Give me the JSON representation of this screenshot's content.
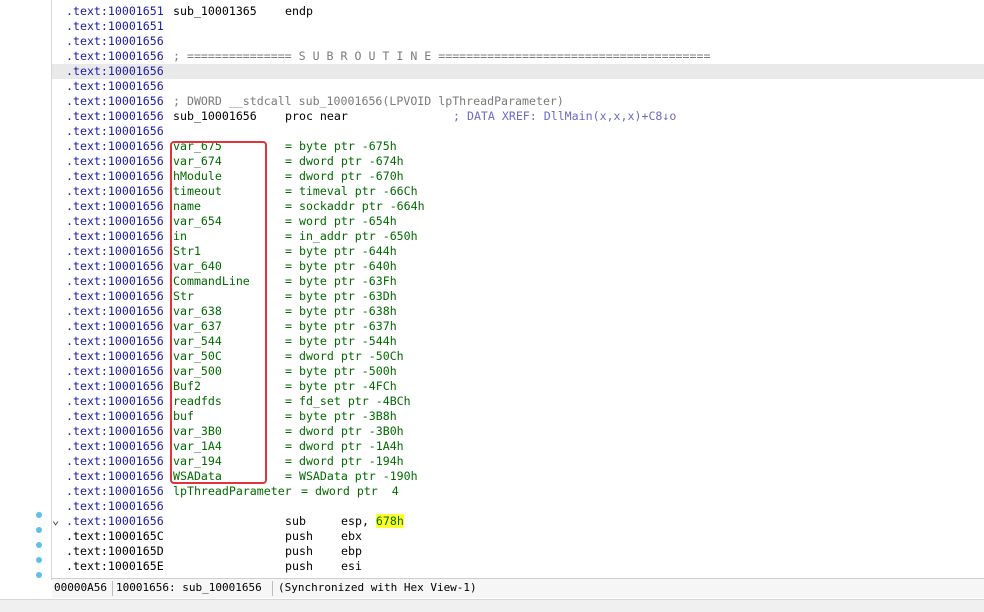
{
  "lines": [
    {
      "addr": ".text:10001651",
      "c2": "sub_10001365",
      "c3": "endp"
    },
    {
      "addr": ".text:10001651"
    },
    {
      "addr": ".text:10001656"
    },
    {
      "addr": ".text:10001656",
      "c2": "; =============== S U B R O U T I N E ======================================="
    },
    {
      "addr": ".text:10001656",
      "sel": true
    },
    {
      "addr": ".text:10001656"
    },
    {
      "addr": ".text:10001656",
      "c2": "; DWORD __stdcall sub_10001656(LPVOID lpThreadParameter)"
    },
    {
      "addr": ".text:10001656",
      "c2": "sub_10001656",
      "c3": "proc near",
      "c5": "; DATA XREF: DllMain(x,x,x)+C8↓o"
    },
    {
      "addr": ".text:10001656"
    },
    {
      "addr": ".text:10001656",
      "var": "var_675",
      "def": "= byte ptr -675h"
    },
    {
      "addr": ".text:10001656",
      "var": "var_674",
      "def": "= dword ptr -674h"
    },
    {
      "addr": ".text:10001656",
      "var": "hModule",
      "def": "= dword ptr -670h"
    },
    {
      "addr": ".text:10001656",
      "var": "timeout",
      "def": "= timeval ptr -66Ch"
    },
    {
      "addr": ".text:10001656",
      "var": "name",
      "def": "= sockaddr ptr -664h"
    },
    {
      "addr": ".text:10001656",
      "var": "var_654",
      "def": "= word ptr -654h"
    },
    {
      "addr": ".text:10001656",
      "var": "in",
      "def": "= in_addr ptr -650h"
    },
    {
      "addr": ".text:10001656",
      "var": "Str1",
      "def": "= byte ptr -644h"
    },
    {
      "addr": ".text:10001656",
      "var": "var_640",
      "def": "= byte ptr -640h"
    },
    {
      "addr": ".text:10001656",
      "var": "CommandLine",
      "def": "= byte ptr -63Fh"
    },
    {
      "addr": ".text:10001656",
      "var": "Str",
      "def": "= byte ptr -63Dh"
    },
    {
      "addr": ".text:10001656",
      "var": "var_638",
      "def": "= byte ptr -638h"
    },
    {
      "addr": ".text:10001656",
      "var": "var_637",
      "def": "= byte ptr -637h"
    },
    {
      "addr": ".text:10001656",
      "var": "var_544",
      "def": "= byte ptr -544h"
    },
    {
      "addr": ".text:10001656",
      "var": "var_50C",
      "def": "= dword ptr -50Ch"
    },
    {
      "addr": ".text:10001656",
      "var": "var_500",
      "def": "= byte ptr -500h"
    },
    {
      "addr": ".text:10001656",
      "var": "Buf2",
      "def": "= byte ptr -4FCh"
    },
    {
      "addr": ".text:10001656",
      "var": "readfds",
      "def": "= fd_set ptr -4BCh"
    },
    {
      "addr": ".text:10001656",
      "var": "buf",
      "def": "= byte ptr -3B8h"
    },
    {
      "addr": ".text:10001656",
      "var": "var_3B0",
      "def": "= dword ptr -3B0h"
    },
    {
      "addr": ".text:10001656",
      "var": "var_1A4",
      "def": "= dword ptr -1A4h"
    },
    {
      "addr": ".text:10001656",
      "var": "var_194",
      "def": "= dword ptr -194h"
    },
    {
      "addr": ".text:10001656",
      "var": "WSAData",
      "def": "= WSAData ptr -190h"
    },
    {
      "addr": ".text:10001656",
      "var": "lpThreadParameter",
      "def2": "= dword ptr  4"
    },
    {
      "addr": ".text:10001656"
    },
    {
      "addr": ".text:10001656",
      "c3": "sub",
      "c4a": "esp, ",
      "c4h": "678h"
    },
    {
      "addr": ".text:1000165C",
      "plain": true,
      "c3": "push",
      "c4": "ebx"
    },
    {
      "addr": ".text:1000165D",
      "plain": true,
      "c3": "push",
      "c4": "ebp"
    },
    {
      "addr": ".text:1000165E",
      "plain": true,
      "c3": "push",
      "c4": "esi"
    }
  ],
  "status": {
    "offset": "00000A56",
    "location": "10001656: sub_10001656",
    "sync": "(Synchronized with Hex View-1)"
  },
  "colors": {
    "address": "#1a1aa6",
    "variable": "#006a00",
    "highlight": "#ffff2e",
    "box": "#e0353b"
  }
}
